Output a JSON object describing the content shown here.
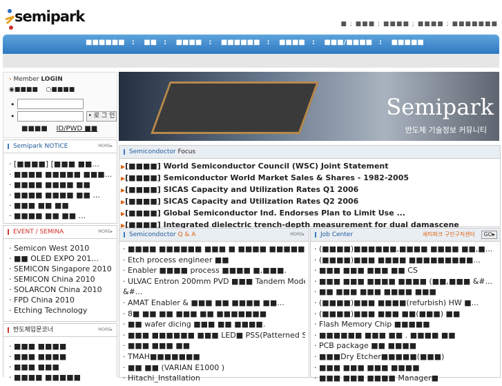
{
  "header": {
    "logo_text": "semipark",
    "util_links": "■ ; ■■■ ; ■■■■ ; ■■■■ ; ■■■■■■■"
  },
  "nav": {
    "items": [
      "■■■■■■",
      "■■",
      "■■■■",
      "■■■■■■",
      "■■■■",
      "■■■/■■■■",
      "■■■■■"
    ],
    "separator": ":"
  },
  "login": {
    "title_prefix": "Member",
    "title_bold": "LOGIN",
    "radio1": "■■■■",
    "radio2": "■■■■",
    "button": "• 로 그 인",
    "join": "■■■■",
    "find": "ID/PWD ■■"
  },
  "notice": {
    "title": "Semipark NOTICE",
    "more": "MORE▸",
    "items": [
      "· [■■■■] [■■■ ■■...",
      "· ■■■■ ■■■■■ ■■■...",
      "· ■■■■ ■■■■ ■■",
      "· ■■■■ ■■■■ ■■ ...",
      "· ■■■ ■■ ■■",
      "· ■■■■ ■■ ■■ ..."
    ]
  },
  "event": {
    "title": "EVENT / SEMINA",
    "more": "MORE▸",
    "items": [
      "· Semicon West 2010",
      "· ■■ OLED EXPO 201...",
      "· SEMICON Singapore 2010",
      "· SEMICON China 2010",
      "· SOLARCON China 2010",
      "· FPD China 2010",
      "· Etching Technology"
    ]
  },
  "intro": {
    "title": "반도체입문코너",
    "more": "MORE▸",
    "items": [
      "· ■■■ ■■■■",
      "· ■■■ ■■■■",
      "· ■■■ ■■■",
      "· ■■■■ ■■■■■"
    ]
  },
  "banner": {
    "title": "Semipark",
    "subtitle": "반도체 기술정보 커뮤니티"
  },
  "focus": {
    "title_prefix": "Semicondoctor",
    "title_suffix": "Focus",
    "items": [
      "[■■■■] World Semiconductor Council (WSC) Joint Statement",
      "[■■■■] Semiconductor World Market Sales & Shares - 1982-2005",
      "[■■■■] SICAS Capacity and Utilization Rates Q1 2006",
      "[■■■■] SICAS Capacity and Utilization Rates Q2 2006",
      "[■■■■] Global Semiconductor Ind. Endorses Plan to Limit Use ...",
      "[■■■■] Integrated dielectric trench-depth measurement for dual damascene"
    ]
  },
  "qa": {
    "title_prefix": "Semicondoctor",
    "title_suffix": "Q & A",
    "more": "MORE▸",
    "items": [
      "· ■■■■ ■■■■■■ ■■■ ■ ■■■■ ■■■■■■...",
      "· Etch process engineer ■■",
      "· Enabler ■■■■ process ■■■■ ■,■■■.",
      "· ULVAC Entron 200mm PVD ■■■ Tandem Model",
      "&#...",
      "· AMAT Enabler & ■■■ ■■ ■■■■ ■■...",
      "· 8■ ■■ ■■ ■■■ ■■ ■■■■■■■",
      "· ■■ wafer dicing ■■■ ■■ ■■■■.",
      "· ■■■ ■■■■■■ ■■■ LED■ PSS(Patterned S...",
      "· ■■■ ■■■ ■■",
      "· TMAH■■■■■■■",
      "· ■■ ■■ (VARIAN E1000 )",
      "· Hitachi_Installation"
    ]
  },
  "job": {
    "title": "Job Center",
    "right_label": "세미파크 구인구직센터",
    "go": "GO▸",
    "items": [
      "· (■■■■)■■■■■■,■■■■ ■■■■ ■■,■...",
      "· (■■■■)■■■ ■■■■ ■■■■■■■■■...",
      "· ■■■ ■■■ ■■■ ■■ CS",
      "· ■■■ ■■■ ■■■■ ■■■■ (■■,■■■ &#...",
      "· ■■ ■■■ ■■■ ■■■■ ■■■",
      "· (■■■■)■■■ ■■■■(refurbish) HW ■...",
      "· (■■■■)■■■ ■■■ ■■(■■■) ■■",
      "· Flash Memory Chip ■■■■■",
      "· ■■■■■■ ■■■ ■■ . ■■■■ ■■",
      "· PCB package ■■ ■■■■",
      "· ■■■Dry Etcher■■■■■(■■■)",
      "· ■■■ ■■■ ■■■ ■■■■",
      "· ■■■ ■■■ ■■■■ Manager■"
    ]
  }
}
